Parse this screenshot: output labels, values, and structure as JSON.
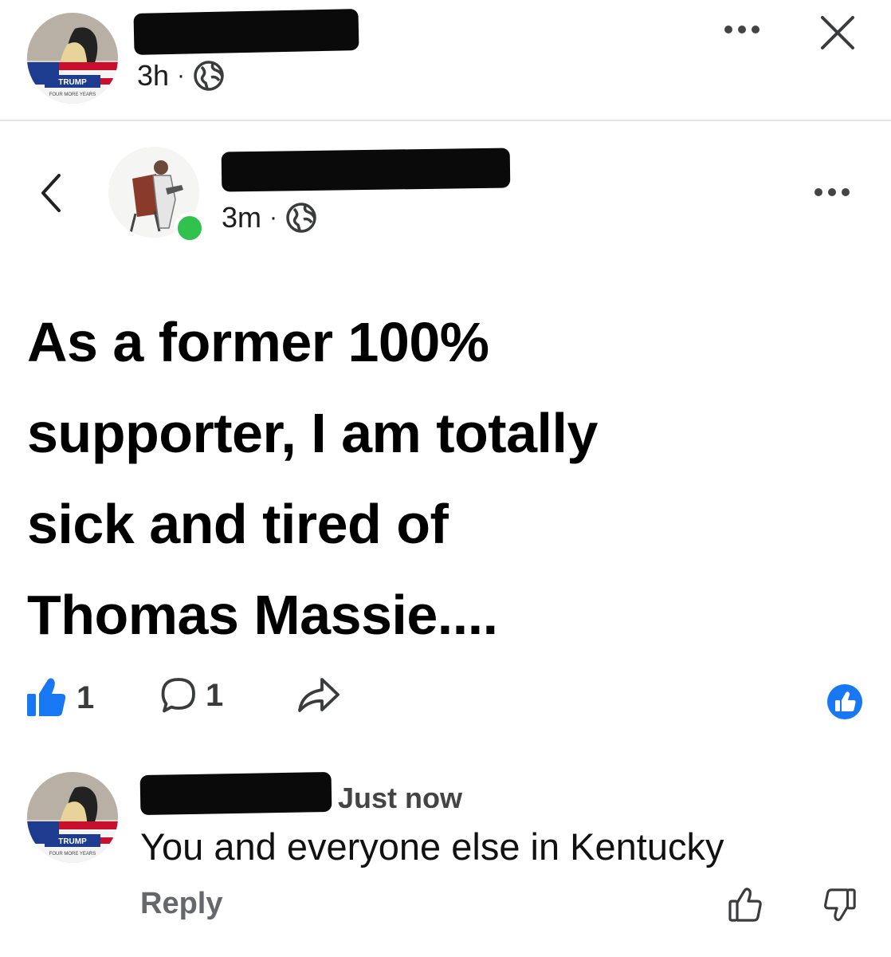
{
  "parent_post": {
    "time": "3h",
    "separator": "·",
    "avatar_badge_text": "TRUMP",
    "avatar_badge_subtext": "FOUR MORE YEARS"
  },
  "shared_post": {
    "time": "3m",
    "separator": "·",
    "text_lines": [
      "As a former 100%",
      "supporter, I am totally",
      "sick and tired of",
      "Thomas Massie...."
    ],
    "like_count": "1",
    "comment_count": "1"
  },
  "comment": {
    "time": "Just now",
    "text": "You and everyone else in Kentucky",
    "reply_label": "Reply",
    "avatar_badge_text": "TRUMP",
    "avatar_badge_subtext": "FOUR MORE YEARS"
  },
  "colors": {
    "facebook_blue": "#1877f2",
    "online_green": "#31c24d",
    "redaction": "#0a0a0a"
  },
  "icons": {
    "top_privacy": "globe-icon",
    "close": "close-icon",
    "back": "chevron-left-icon",
    "like": "thumbs-up-icon",
    "comment": "comment-bubble-icon",
    "share": "share-arrow-icon"
  }
}
